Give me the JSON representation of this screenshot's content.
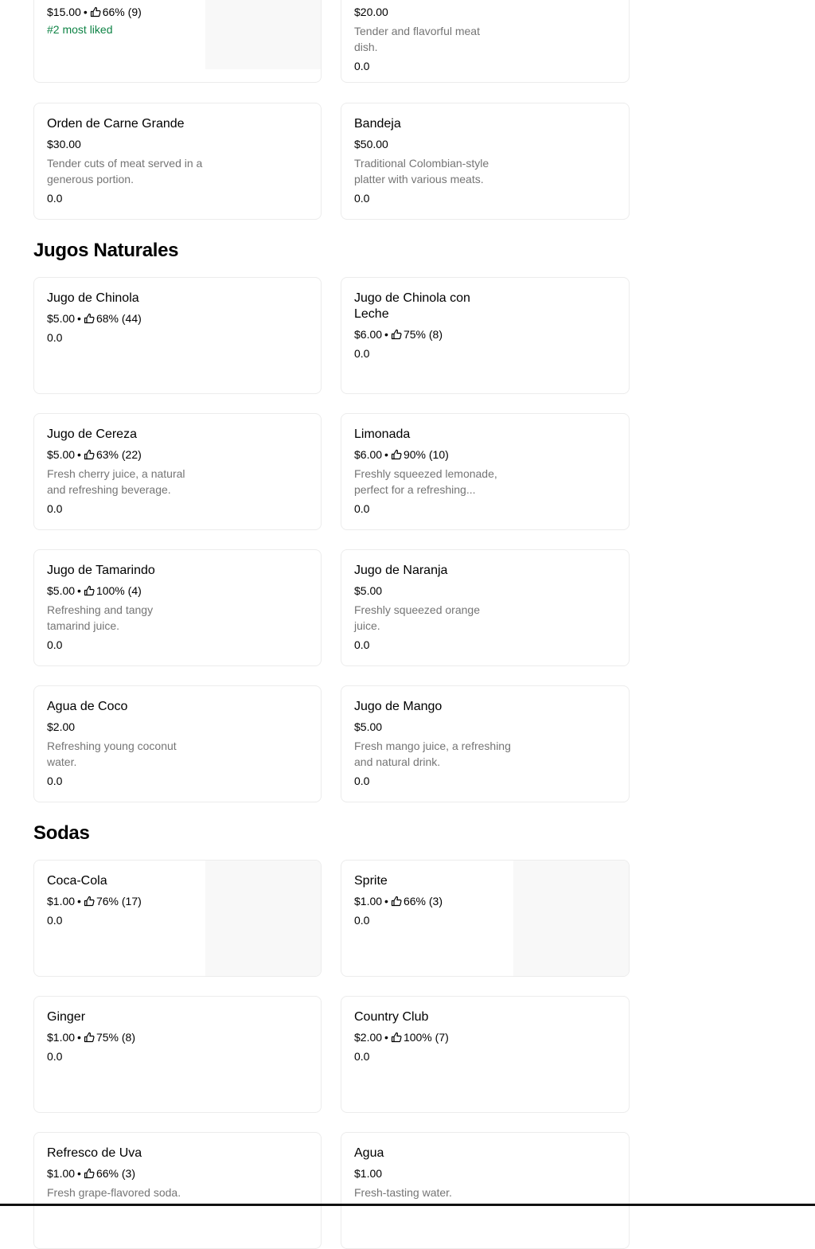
{
  "top_cards": {
    "left": {
      "price": "$15.00",
      "like_pct": "66%",
      "like_count": "(9)",
      "badge": "#2 most liked"
    },
    "right": {
      "price": "$20.00",
      "description": "Tender and flavorful meat dish.",
      "rating": "0.0"
    }
  },
  "carne": {
    "items": [
      {
        "name": "Orden de Carne Grande",
        "price": "$30.00",
        "description": "Tender cuts of meat served in a generous portion.",
        "rating": "0.0"
      },
      {
        "name": "Bandeja",
        "price": "$50.00",
        "description": "Traditional Colombian-style platter with various meats.",
        "rating": "0.0"
      }
    ]
  },
  "jugos": {
    "title": "Jugos Naturales",
    "items": [
      {
        "name": "Jugo de Chinola",
        "price": "$5.00",
        "like_pct": "68%",
        "like_count": "(44)",
        "rating": "0.0"
      },
      {
        "name": "Jugo de Chinola con Leche",
        "price": "$6.00",
        "like_pct": "75%",
        "like_count": "(8)",
        "rating": "0.0"
      },
      {
        "name": "Jugo de Cereza",
        "price": "$5.00",
        "like_pct": "63%",
        "like_count": "(22)",
        "description": "Fresh cherry juice, a natural and refreshing beverage.",
        "rating": "0.0"
      },
      {
        "name": "Limonada",
        "price": "$6.00",
        "like_pct": "90%",
        "like_count": "(10)",
        "description": "Freshly squeezed lemonade, perfect for a refreshing...",
        "rating": "0.0"
      },
      {
        "name": "Jugo de Tamarindo",
        "price": "$5.00",
        "like_pct": "100%",
        "like_count": "(4)",
        "description": "Refreshing and tangy tamarind juice.",
        "rating": "0.0"
      },
      {
        "name": "Jugo de Naranja",
        "price": "$5.00",
        "description": "Freshly squeezed orange juice.",
        "rating": "0.0"
      },
      {
        "name": "Agua de Coco",
        "price": "$2.00",
        "description": "Refreshing young coconut water.",
        "rating": "0.0"
      },
      {
        "name": "Jugo de Mango",
        "price": "$5.00",
        "description": "Fresh mango juice, a refreshing and natural drink.",
        "rating": "0.0"
      }
    ]
  },
  "sodas": {
    "title": "Sodas",
    "items": [
      {
        "name": "Coca-Cola",
        "price": "$1.00",
        "like_pct": "76%",
        "like_count": "(17)",
        "rating": "0.0"
      },
      {
        "name": "Sprite",
        "price": "$1.00",
        "like_pct": "66%",
        "like_count": "(3)",
        "rating": "0.0"
      },
      {
        "name": "Ginger",
        "price": "$1.00",
        "like_pct": "75%",
        "like_count": "(8)",
        "rating": "0.0"
      },
      {
        "name": "Country Club",
        "price": "$2.00",
        "like_pct": "100%",
        "like_count": "(7)",
        "rating": "0.0"
      },
      {
        "name": "Refresco de Uva",
        "price": "$1.00",
        "like_pct": "66%",
        "like_count": "(3)",
        "description": "Fresh grape-flavored soda."
      },
      {
        "name": "Agua",
        "price": "$1.00",
        "description": "Fresh-tasting water."
      }
    ]
  },
  "separator": "•",
  "icons": {
    "like": "thumbs-up-icon"
  },
  "colors": {
    "badge": "#0e8345",
    "description": "#757575",
    "card_border": "#ececec"
  }
}
